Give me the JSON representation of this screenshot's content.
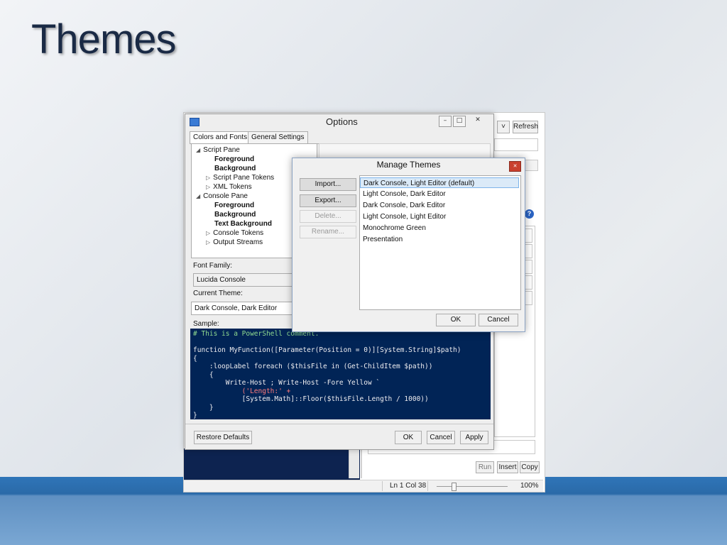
{
  "slide": {
    "title": "Themes"
  },
  "ise": {
    "refresh_label": "Refresh",
    "dropdown_glyph": "˅",
    "run_label": "Run",
    "insert_label": "Insert",
    "copy_label": "Copy",
    "help_icon": "?",
    "status": {
      "position": "Ln 1  Col 38",
      "zoom": "100%"
    }
  },
  "options": {
    "title": "Options",
    "tabs": [
      "Colors and Fonts",
      "General Settings"
    ],
    "tree": [
      {
        "label": "Script Pane",
        "expanded": true,
        "bold": false
      },
      {
        "label": "Foreground",
        "bold": true
      },
      {
        "label": "Background",
        "bold": true
      },
      {
        "label": "Script Pane Tokens",
        "expanded": false,
        "bold": false
      },
      {
        "label": "XML Tokens",
        "expanded": false,
        "bold": false
      },
      {
        "label": "Console Pane",
        "expanded": true,
        "bold": false
      },
      {
        "label": "Foreground",
        "bold": true
      },
      {
        "label": "Background",
        "bold": true
      },
      {
        "label": "Text Background",
        "bold": true
      },
      {
        "label": "Console Tokens",
        "expanded": false,
        "bold": false
      },
      {
        "label": "Output Streams",
        "expanded": false,
        "bold": false
      }
    ],
    "font_family_label": "Font Family:",
    "font_family_value": "Lucida Console",
    "current_theme_label": "Current Theme:",
    "current_theme_value": "Dark Console, Dark Editor",
    "sample_label": "Sample:",
    "sample_code": [
      "# This is a PowerShell comment.",
      "",
      "function MyFunction([Parameter(Position = 0)][System.String]$path)",
      "{",
      "    :loopLabel foreach ($thisFile in (Get-ChildItem $path))",
      "    {",
      "        Write-Host ; Write-Host -Fore Yellow `",
      "            ('Length:' +",
      "            [System.Math]::Floor($thisFile.Length / 1000))",
      "    }",
      "}"
    ],
    "restore_defaults_label": "Restore Defaults",
    "ok_label": "OK",
    "cancel_label": "Cancel",
    "apply_label": "Apply"
  },
  "manage_themes": {
    "title": "Manage Themes",
    "buttons": [
      {
        "label": "Import...",
        "enabled": true
      },
      {
        "label": "Export...",
        "enabled": true
      },
      {
        "label": "Delete...",
        "enabled": false
      },
      {
        "label": "Rename...",
        "enabled": false
      }
    ],
    "themes": [
      "Dark Console, Light Editor (default)",
      "Light Console, Dark Editor",
      "Dark Console, Dark Editor",
      "Light Console, Light Editor",
      "Monochrome Green",
      "Presentation"
    ],
    "selected_index": 0,
    "ok_label": "OK",
    "cancel_label": "Cancel"
  }
}
